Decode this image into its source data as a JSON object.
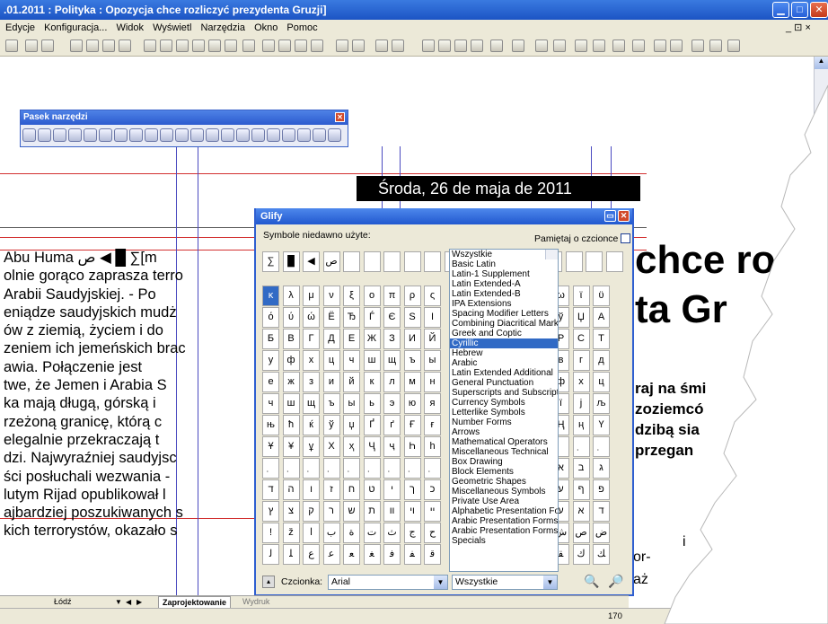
{
  "window": {
    "title": ".01.2011 : Polityka : Opozycja chce rozliczyć prezydenta Gruzji]",
    "min": "▁",
    "max": "□",
    "close": "✕"
  },
  "menu": [
    "Edycje",
    "Konfiguracja...",
    "Widok",
    "Wyświetl",
    "Narzędzia",
    "Okno",
    "Pomoc"
  ],
  "menu_right": "_ ⊡ ×",
  "page": {
    "date": "Środa, 26 de maja de 2011",
    "headline1": "chce ro",
    "headline2": "ta Gr",
    "subheads": [
      "raj na śmi",
      "zoziemcó",
      "dzibą sia",
      "przegan"
    ],
    "article_lines": [
      "Abu Huma ص ◀ █ ∑[m",
      "olnie gorąco zaprasza terro",
      " Arabii Saudyjskiej. - Po",
      "eniądze saudyjskich mudż",
      "ów z ziemią, życiem i do",
      "zeniem ich jemeńskich brac",
      "awia.  Połączenie  jest",
      "twe, że Jemen i Arabia S",
      "ka mają długą, górską i",
      "rzeżoną granicę, którą c",
      "elegalnie przekraczają t",
      "dzi. Najwyraźniej saudyjsc",
      "ści posłuchali wezwania -",
      " lutym Rijad opublikował l",
      "ajbardziej poszukiwanych s",
      "kich terrorystów, okazało s"
    ],
    "right_fragments": [
      "i",
      "or-",
      "aż"
    ]
  },
  "pasek": {
    "title": "Pasek narzędzi",
    "close": "✕"
  },
  "glify": {
    "title": "Glify",
    "recent_label": "Symbole niedawno użyte:",
    "remember_label": "Pamiętaj o czcionce",
    "recent": [
      "∑",
      "█",
      "◀",
      "ص"
    ],
    "grid": [
      [
        "κ",
        "λ",
        "μ",
        "ν",
        "ξ",
        "ο",
        "π",
        "ρ",
        "ς"
      ],
      [
        "ό",
        "ύ",
        "ώ",
        "Ё",
        "Ђ",
        "Ѓ",
        "Є",
        "S",
        "І"
      ],
      [
        "Б",
        "В",
        "Г",
        "Д",
        "Е",
        "Ж",
        "З",
        "И",
        "Й"
      ],
      [
        "у",
        "ф",
        "х",
        "ц",
        "ч",
        "ш",
        "щ",
        "ъ",
        "ы"
      ],
      [
        "е",
        "ж",
        "з",
        "и",
        "й",
        "к",
        "л",
        "м",
        "н"
      ],
      [
        "ч",
        "ш",
        "щ",
        "ъ",
        "ы",
        "ь",
        "э",
        "ю",
        "я"
      ],
      [
        "њ",
        "ћ",
        "ќ",
        "ў",
        "џ",
        "Ґ",
        "ґ",
        "Ғ",
        "ғ"
      ],
      [
        "Ұ",
        "¥",
        "ұ",
        "Χ",
        "ҳ",
        "Ҷ",
        "ҷ",
        "Һ",
        "һ"
      ],
      [
        "̣",
        "̣",
        "̣",
        "̣",
        "̣",
        "̣",
        "̣",
        "̣",
        "̣"
      ],
      [
        "ד",
        "ה",
        "ו",
        "ז",
        "ח",
        "ט",
        "י",
        "ך",
        "כ"
      ],
      [
        "ץ",
        "צ",
        "ק",
        "ר",
        "ש",
        "ת",
        "װ",
        "ױ",
        "ײ"
      ],
      [
        "!",
        "ž",
        "ا",
        "ب",
        "ة",
        "ت",
        "ث",
        "ج",
        "ح"
      ],
      [
        "ﻟ",
        "ﻠ",
        "ﻉ",
        "ﻋ",
        "ﻌ",
        "ﻐ",
        "ﻓ",
        "ﻔ",
        "ﻗ"
      ]
    ],
    "grid2": [
      [
        "ω",
        "ϊ",
        "ϋ"
      ],
      [
        "ў",
        "Џ",
        "А"
      ],
      [
        "Р",
        "С",
        "Т"
      ],
      [
        "в",
        "г",
        "д"
      ],
      [
        "ф",
        "х",
        "ц"
      ],
      [
        "ї",
        "ј",
        "љ"
      ],
      [
        "Ң",
        "ң",
        "Ү"
      ],
      [
        "̣",
        "̣",
        "̣"
      ],
      [
        "א",
        "ב",
        "ג"
      ],
      [
        "ע",
        "ף",
        "פ"
      ],
      [
        "ﬠ",
        "ﬡ",
        "ﬢ"
      ],
      [
        "ش",
        "ص",
        "ض"
      ],
      [
        "ﻘ",
        "ﻙ",
        "ﻚ"
      ]
    ],
    "categories": [
      "Wszystkie",
      "Basic Latin",
      "Latin-1 Supplement",
      "Latin Extended-A",
      "Latin Extended-B",
      "IPA Extensions",
      "Spacing Modifier Letters",
      "Combining Diacritical Marks",
      "Greek and Coptic",
      "Cyrillic",
      "Hebrew",
      "Arabic",
      "Latin Extended Additional",
      "General Punctuation",
      "Superscripts and Subscripts",
      "Currency Symbols",
      "Letterlike Symbols",
      "Number Forms",
      "Arrows",
      "Mathematical Operators",
      "Miscellaneous Technical",
      "Box Drawing",
      "Block Elements",
      "Geometric Shapes",
      "Miscellaneous Symbols",
      "Private Use Area",
      "Alphabetic Presentation Forms",
      "Arabic Presentation Forms-A",
      "Arabic Presentation Forms-B",
      "Specials"
    ],
    "selected_category": "Cyrillic",
    "font_label": "Czcionka:",
    "font_value": "Arial",
    "subset_value": "Wszystkie"
  },
  "tabs": {
    "layer": "Łódź",
    "active_tab": "Zaprojektowanie",
    "other_tab": "Wydruk"
  },
  "status": {
    "zoom": "170"
  }
}
